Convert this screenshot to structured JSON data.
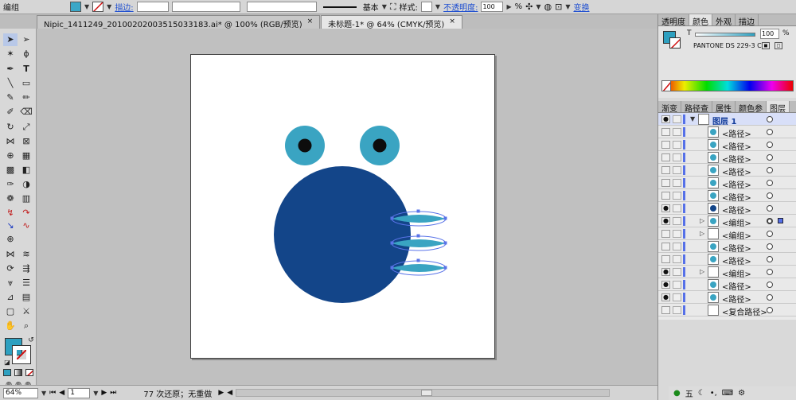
{
  "control": {
    "selection_label": "编组",
    "stroke_label": "描边:",
    "stroke_value": "",
    "style_profile_label": "基本",
    "style_label": "样式:",
    "opacity_label": "不透明度:",
    "opacity_value": "100",
    "opacity_unit": "%",
    "transform_label": "变换",
    "fill_color": "#3aa7c7",
    "stroke_color": "#ffffff"
  },
  "tabs": [
    {
      "label": "Nipic_1411249_20100202003515033183.ai* @ 100% (RGB/预览)",
      "close": "×",
      "active": false
    },
    {
      "label": "未标题-1* @ 64% (CMYK/预览)",
      "close": "×",
      "active": true
    }
  ],
  "artwork": {
    "body_color": "#134589",
    "eye_color": "#3aa4c2",
    "pupil_color": "#0d0d0d",
    "fin_color": "#3aa4c2",
    "selection_color": "#5a74e8"
  },
  "status": {
    "zoom": "64%",
    "artboard": "1",
    "message": "77 次还原；无重做"
  },
  "color_panel": {
    "tabs": [
      "透明度",
      "颜色",
      "外观",
      "描边"
    ],
    "active_tab": "颜色",
    "tint_prefix": "T",
    "tint_value": "100",
    "tint_unit": "%",
    "swatch_name": "PANTONE DS 229-3 C",
    "fill": "#2ea0c0"
  },
  "layers_panel": {
    "tabs": [
      "渐变",
      "路径查",
      "属性",
      "颜色参",
      "图层"
    ],
    "active_tab": "图层",
    "rows": [
      {
        "name": "图层 1",
        "visible": true,
        "expanded": true,
        "is_layer": true,
        "thumb": "#ffffff"
      },
      {
        "name": "<路径>",
        "visible": false,
        "thumb": "#3aa4c2"
      },
      {
        "name": "<路径>",
        "visible": false,
        "thumb": "#3aa4c2"
      },
      {
        "name": "<路径>",
        "visible": false,
        "thumb": "#3aa4c2"
      },
      {
        "name": "<路径>",
        "visible": false,
        "thumb": "#3aa4c2"
      },
      {
        "name": "<路径>",
        "visible": false,
        "thumb": "#3aa4c2"
      },
      {
        "name": "<路径>",
        "visible": false,
        "thumb": "#3aa4c2"
      },
      {
        "name": "<路径>",
        "visible": true,
        "thumb": "#134589"
      },
      {
        "name": "<编组>",
        "visible": true,
        "expandable": true,
        "selected": true,
        "thumb": "#3aa4c2"
      },
      {
        "name": "<编组>",
        "visible": false,
        "expandable": true,
        "thumb": "#ffffff"
      },
      {
        "name": "<路径>",
        "visible": false,
        "thumb": "#3aa4c2"
      },
      {
        "name": "<路径>",
        "visible": false,
        "thumb": "#3aa4c2"
      },
      {
        "name": "<编组>",
        "visible": true,
        "expandable": true,
        "thumb": "#ffffff"
      },
      {
        "name": "<路径>",
        "visible": true,
        "thumb": "#3aa4c2"
      },
      {
        "name": "<路径>",
        "visible": true,
        "thumb": "#3aa4c2"
      },
      {
        "name": "<复合路径>",
        "visible": false,
        "thumb": "#ffffff"
      }
    ]
  },
  "taskbar": {
    "ime": "五"
  }
}
